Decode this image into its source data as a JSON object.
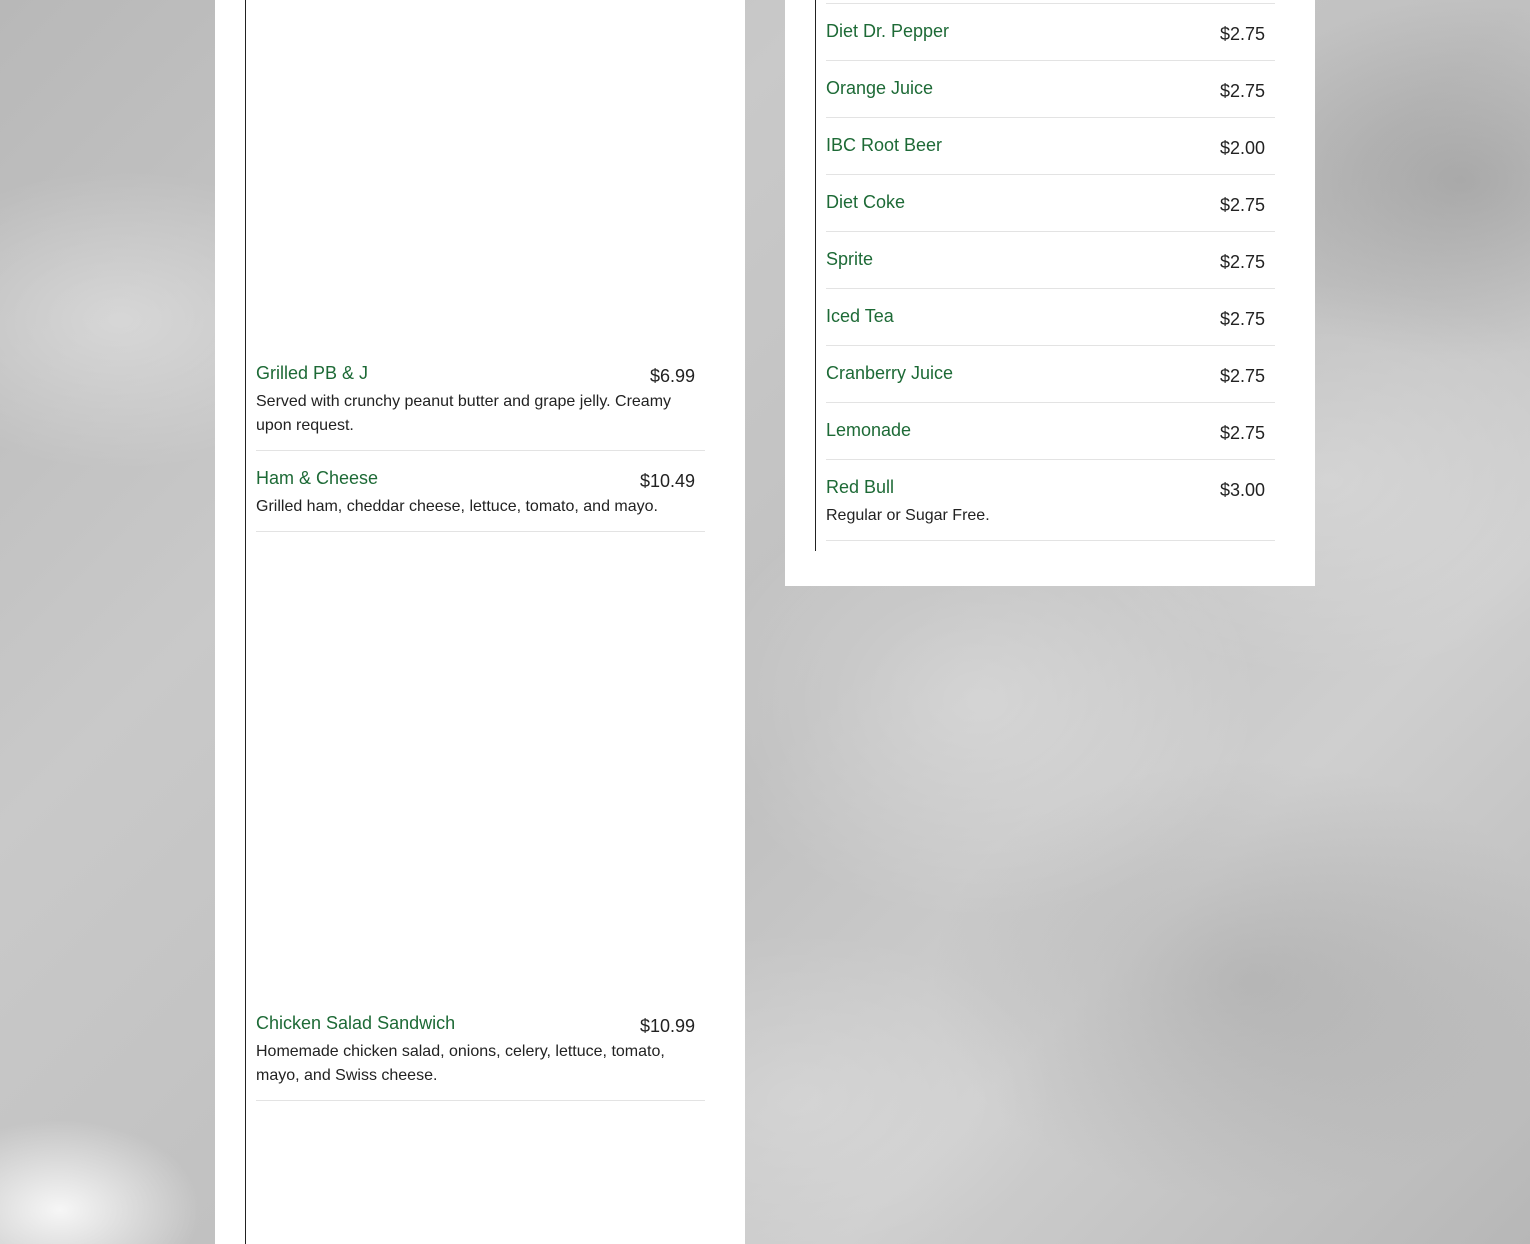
{
  "left_menu": {
    "items": [
      {
        "name": "Grilled PB & J",
        "price": "$6.99",
        "description": "Served with crunchy peanut butter and grape jelly. Creamy upon request."
      },
      {
        "name": "Ham & Cheese",
        "price": "$10.49",
        "description": "Grilled ham, cheddar cheese, lettuce, tomato, and mayo."
      },
      {
        "name": "Chicken Salad Sandwich",
        "price": "$10.99",
        "description": "Homemade chicken salad, onions, celery, lettuce, tomato, mayo, and Swiss cheese."
      }
    ]
  },
  "right_menu": {
    "items": [
      {
        "name": "Diet Dr. Pepper",
        "price": "$2.75"
      },
      {
        "name": "Orange Juice",
        "price": "$2.75"
      },
      {
        "name": "IBC Root Beer",
        "price": "$2.00"
      },
      {
        "name": "Diet Coke",
        "price": "$2.75"
      },
      {
        "name": "Sprite",
        "price": "$2.75"
      },
      {
        "name": "Iced Tea",
        "price": "$2.75"
      },
      {
        "name": "Cranberry Juice",
        "price": "$2.75"
      },
      {
        "name": "Lemonade",
        "price": "$2.75"
      },
      {
        "name": "Red Bull",
        "price": "$3.00",
        "description": "Regular or Sugar Free."
      }
    ]
  },
  "colors": {
    "item_name": "#1d6a36",
    "text": "#222222",
    "divider": "#e3e3e3",
    "panel": "#ffffff"
  }
}
